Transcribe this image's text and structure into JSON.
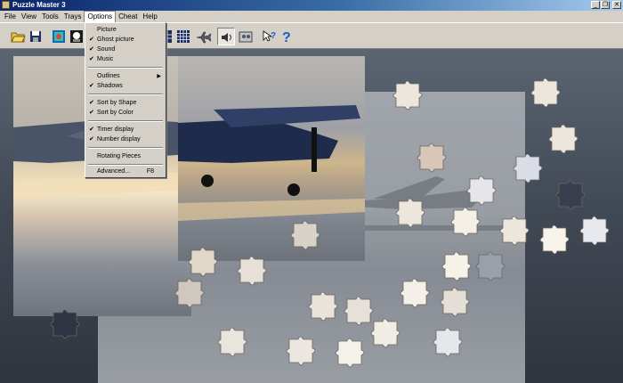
{
  "window": {
    "title": "Puzzle Master 3"
  },
  "menubar": {
    "items": [
      "File",
      "View",
      "Tools",
      "Trays",
      "Options",
      "Cheat",
      "Help"
    ]
  },
  "toolbar": {
    "buttons": [
      "open-icon",
      "save-icon",
      "picture-icon",
      "ghost-picture-icon",
      "sound-icon",
      "music-icon",
      "grid-small-icon",
      "grid-large-icon",
      "airplane-icon",
      "speaker-icon",
      "pieces-tray-icon",
      "whats-this-icon",
      "help-icon"
    ]
  },
  "options_menu": {
    "items": [
      {
        "label": "Picture",
        "checked": false
      },
      {
        "label": "Ghost picture",
        "checked": true
      },
      {
        "label": "Sound",
        "checked": true
      },
      {
        "label": "Music",
        "checked": true
      },
      {
        "label": "Outlines",
        "submenu": true
      },
      {
        "label": "Shadows",
        "checked": true
      },
      {
        "label": "Sort by Shape",
        "checked": true
      },
      {
        "label": "Sort by Color",
        "checked": true
      },
      {
        "label": "Timer display",
        "checked": true
      },
      {
        "label": "Number display",
        "checked": true
      },
      {
        "label": "Rotating Pieces",
        "checked": false
      },
      {
        "label": "Advanced...",
        "accel": "F8"
      }
    ],
    "check_glyph": "✔",
    "submenu_glyph": "▶"
  },
  "window_buttons": {
    "minimize": "_",
    "restore": "❐",
    "close": "✕"
  },
  "colors": {
    "titlebar": "#0a246a",
    "face": "#d4d0c8",
    "workspace": "#4a5360"
  }
}
